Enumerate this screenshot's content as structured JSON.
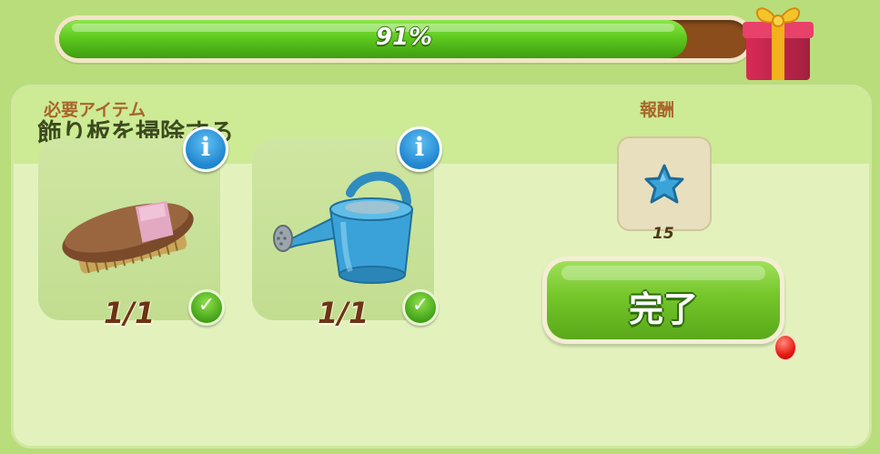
{
  "progress": {
    "label": "91%",
    "value": 0.91
  },
  "task": {
    "title": "飾り板を掃除する"
  },
  "required": {
    "label": "必要アイテム",
    "items": [
      {
        "icon": "brush-icon",
        "count": "1/1",
        "complete": true
      },
      {
        "icon": "watering-can-icon",
        "count": "1/1",
        "complete": true
      }
    ]
  },
  "reward": {
    "label": "報酬",
    "icon": "star-icon",
    "amount": "15"
  },
  "complete_button": {
    "label": "完了"
  },
  "colors": {
    "accent_green": "#5fca1f",
    "panel": "#e3f2bd",
    "info_blue": "#2085cf",
    "notification_red": "#e51a10"
  }
}
